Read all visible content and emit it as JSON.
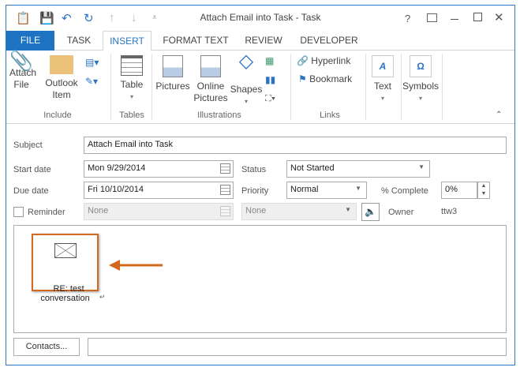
{
  "window": {
    "title": "Attach Email into Task - Task"
  },
  "tabs": [
    {
      "label": "FILE"
    },
    {
      "label": "TASK"
    },
    {
      "label": "INSERT"
    },
    {
      "label": "FORMAT TEXT"
    },
    {
      "label": "REVIEW"
    },
    {
      "label": "DEVELOPER"
    }
  ],
  "ribbon": {
    "include": {
      "label": "Include",
      "attach_file": "Attach\nFile",
      "outlook_item": "Outlook\nItem"
    },
    "tables": {
      "label": "Tables",
      "table": "Table"
    },
    "illustrations": {
      "label": "Illustrations",
      "pictures": "Pictures",
      "online_pictures": "Online\nPictures",
      "shapes": "Shapes"
    },
    "links": {
      "label": "Links",
      "hyperlink": "Hyperlink",
      "bookmark": "Bookmark"
    },
    "text": "Text",
    "symbols": "Symbols"
  },
  "form": {
    "subject_label": "Subject",
    "subject": "Attach Email into Task",
    "start_label": "Start date",
    "start": "Mon 9/29/2014",
    "due_label": "Due date",
    "due": "Fri 10/10/2014",
    "status_label": "Status",
    "status": "Not Started",
    "priority_label": "Priority",
    "priority": "Normal",
    "complete_label": "% Complete",
    "complete": "0%",
    "reminder_label": "Reminder",
    "reminder_date": "None",
    "reminder_time": "None",
    "owner_label": "Owner",
    "owner": "ttw3"
  },
  "body": {
    "attachment": "RE: test\nconversation"
  },
  "footer": {
    "contacts": "Contacts..."
  },
  "colors": {
    "accent": "#1e73c3",
    "arrow": "#d2691e"
  }
}
